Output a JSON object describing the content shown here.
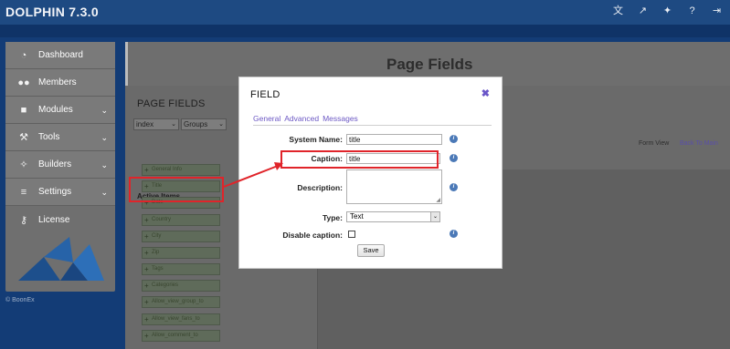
{
  "app": {
    "brand": "DOLPHIN 7.3.0"
  },
  "topbar_icons": [
    "language-icon",
    "external-link-icon",
    "puzzle-icon",
    "help-icon",
    "logout-icon"
  ],
  "sidebar": {
    "items": [
      {
        "label": "Dashboard",
        "icon": "dashboard-icon",
        "chevron": false
      },
      {
        "label": "Members",
        "icon": "users-icon",
        "chevron": false
      },
      {
        "label": "Modules",
        "icon": "modules-icon",
        "chevron": true
      },
      {
        "label": "Tools",
        "icon": "wrench-icon",
        "chevron": true
      },
      {
        "label": "Builders",
        "icon": "wand-icon",
        "chevron": true
      },
      {
        "label": "Settings",
        "icon": "sliders-icon",
        "chevron": true
      },
      {
        "label": "License",
        "icon": "key-icon",
        "chevron": false
      }
    ],
    "copyright": "© BoonEx"
  },
  "main": {
    "page_title": "Page Fields",
    "panel_title": "PAGE FIELDS",
    "select_page": "index",
    "select_groups": "Groups",
    "active_items_label": "Active Items",
    "items": [
      "General Info",
      "Title",
      "Date",
      "Country",
      "City",
      "Zip",
      "Tags",
      "Categories",
      "Allow_view_group_to",
      "Allow_view_fans_to",
      "Allow_comment_to"
    ],
    "links": {
      "form_view": "Form View",
      "back_to_main": "Back To Main"
    }
  },
  "dialog": {
    "title": "FIELD",
    "tabs": [
      "General",
      "Advanced",
      "Messages"
    ],
    "fields": {
      "system_name_label": "System Name:",
      "system_name_value": "title",
      "caption_label": "Caption:",
      "caption_value": "title",
      "description_label": "Description:",
      "description_value": "",
      "type_label": "Type:",
      "type_value": "Text",
      "disable_caption_label": "Disable caption:"
    },
    "save_label": "Save",
    "info_glyph": "i"
  },
  "colors": {
    "annotation_red": "#e0242a",
    "link_purple": "#6c58c4",
    "topbar_blue": "#1e4a82"
  }
}
